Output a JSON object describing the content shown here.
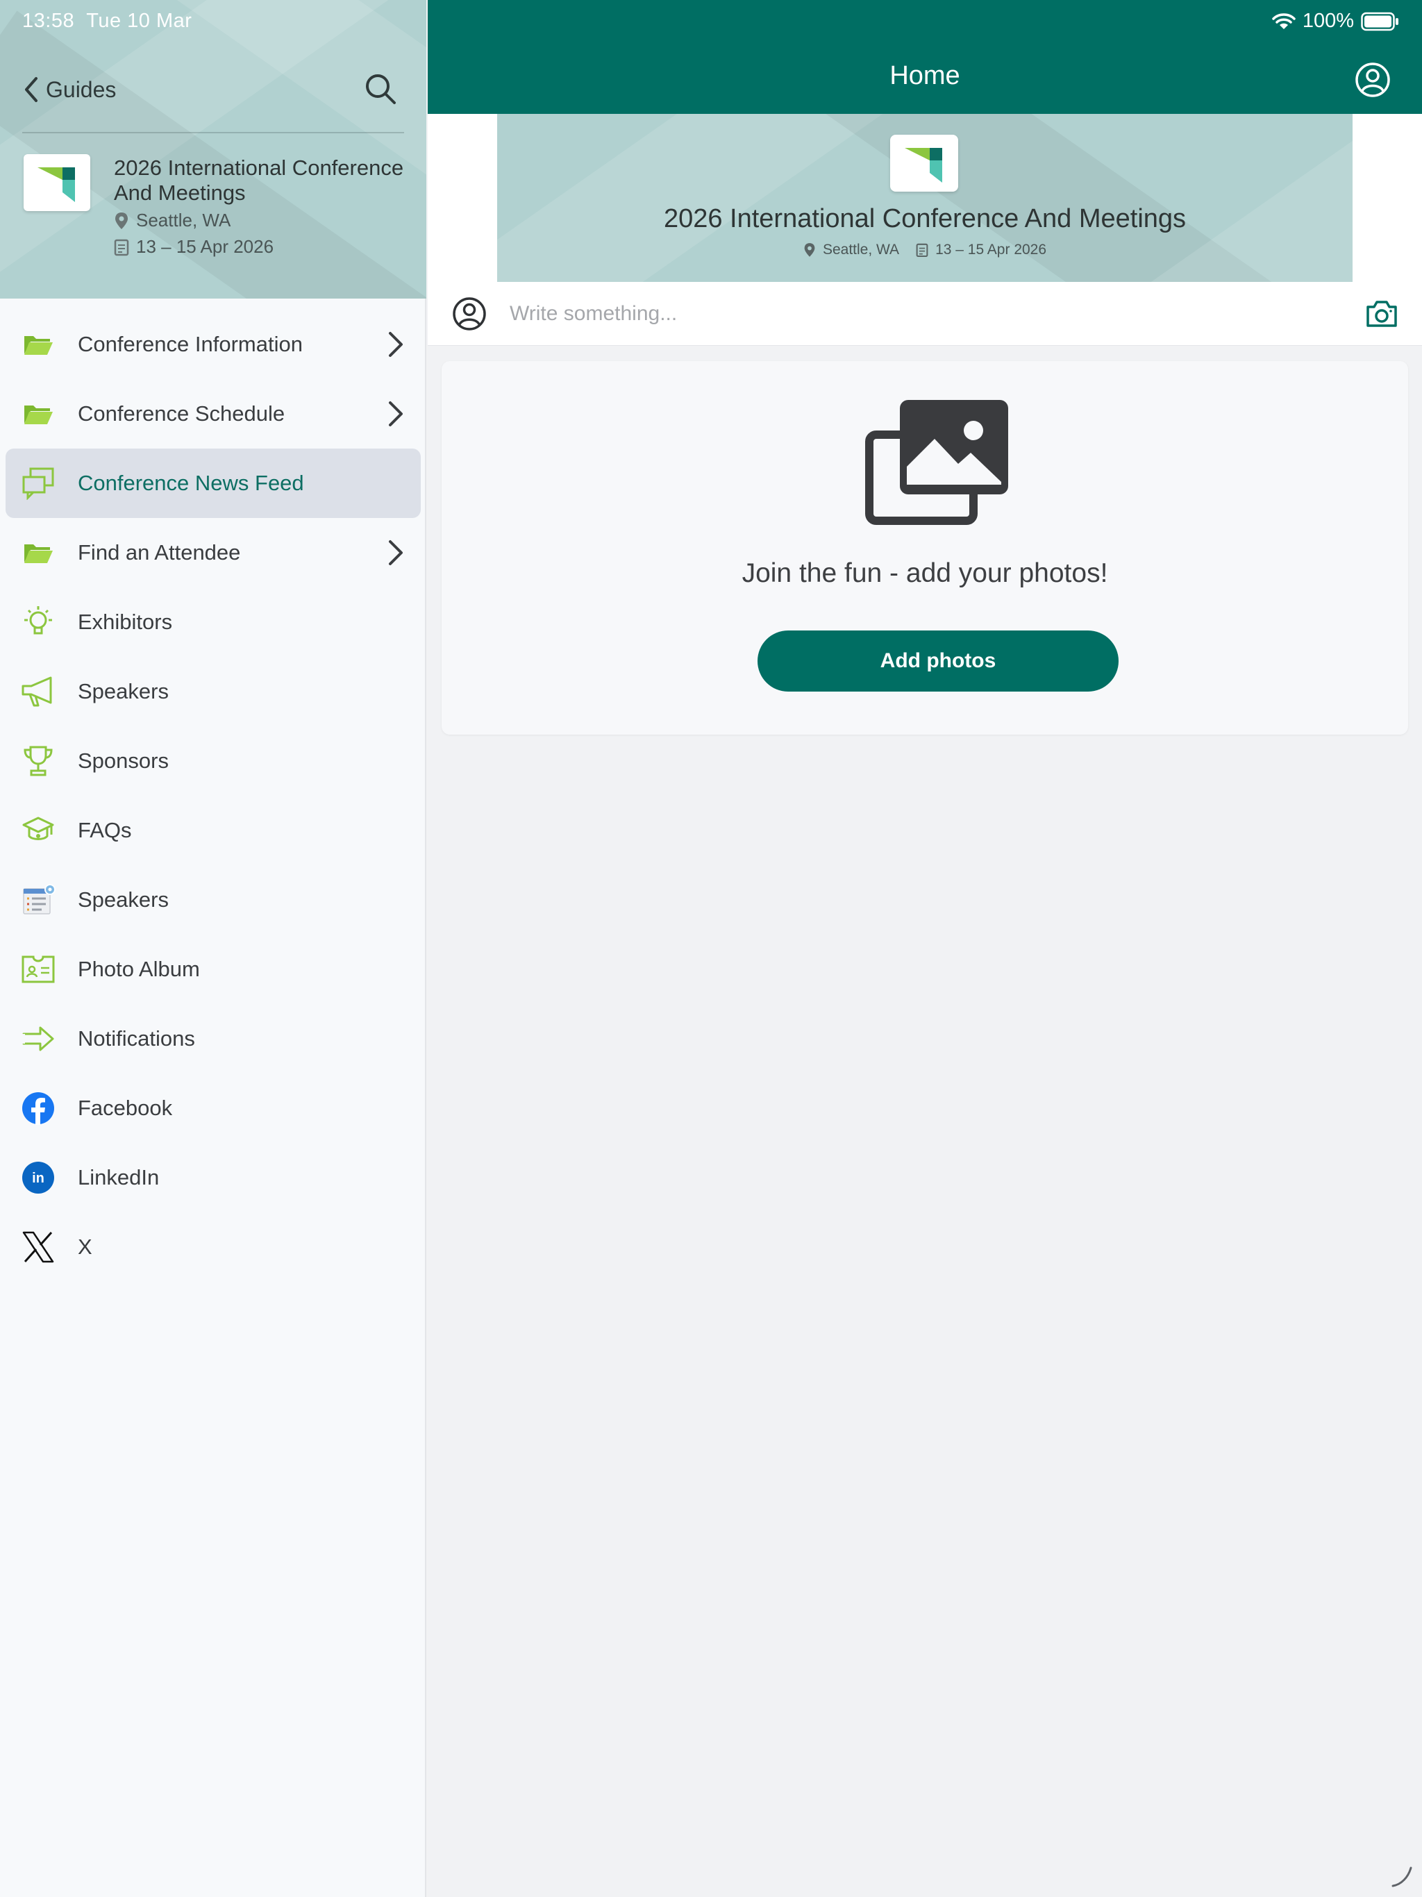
{
  "status_bar": {
    "time": "13:58",
    "date": "Tue 10 Mar",
    "battery": "100%"
  },
  "sidebar": {
    "back_label": "Guides",
    "event": {
      "title": "2026 International Conference And Meetings",
      "location": "Seattle, WA",
      "dates": "13 – 15 Apr 2026"
    },
    "items": [
      {
        "label": "Conference Information",
        "icon": "folder-icon",
        "chevron": true
      },
      {
        "label": "Conference Schedule",
        "icon": "folder-icon",
        "chevron": true
      },
      {
        "label": "Conference News Feed",
        "icon": "chat-bubbles-icon",
        "active": true
      },
      {
        "label": "Find an Attendee",
        "icon": "folder-icon",
        "chevron": true
      },
      {
        "label": "Exhibitors",
        "icon": "lightbulb-icon"
      },
      {
        "label": "Speakers",
        "icon": "megaphone-icon"
      },
      {
        "label": "Sponsors",
        "icon": "trophy-icon"
      },
      {
        "label": "FAQs",
        "icon": "graduation-cap-icon"
      },
      {
        "label": "Speakers",
        "icon": "schedule-list-icon"
      },
      {
        "label": "Photo Album",
        "icon": "id-card-icon"
      },
      {
        "label": "Notifications",
        "icon": "arrow-right-icon"
      },
      {
        "label": "Facebook",
        "icon": "facebook-icon"
      },
      {
        "label": "LinkedIn",
        "icon": "linkedin-icon"
      },
      {
        "label": "X",
        "icon": "x-logo-icon"
      }
    ]
  },
  "main": {
    "title": "Home",
    "hero": {
      "title": "2026 International Conference And Meetings",
      "location": "Seattle, WA",
      "dates": "13 – 15 Apr 2026"
    },
    "composer": {
      "placeholder": "Write something..."
    },
    "photo_card": {
      "message": "Join the fun - add your photos!",
      "button_label": "Add photos"
    }
  },
  "colors": {
    "brand": "#006e63",
    "header_bg": "#b1d1d0",
    "icon_green": "#8cc63f",
    "active_bg": "#dce0e8"
  }
}
